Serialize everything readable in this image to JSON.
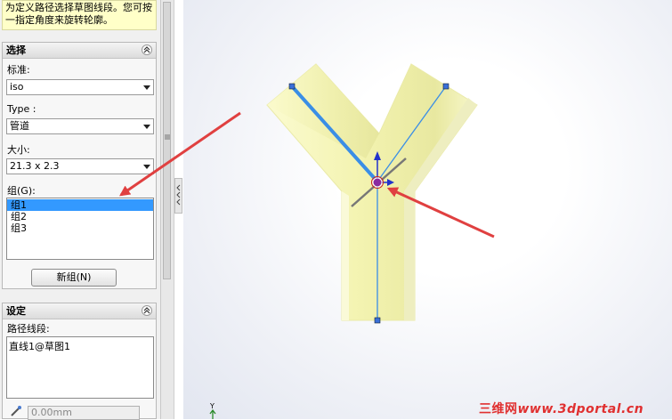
{
  "help_text": "为定义路径选择草图线段。您可按一指定角度来旋转轮廓。",
  "selection": {
    "title": "选择",
    "standard_label": "标准:",
    "standard_value": "iso",
    "type_label": "Type :",
    "type_value": "管道",
    "size_label": "大小:",
    "size_value": "21.3 x 2.3",
    "group_label": "组(G):",
    "groups": [
      "组1",
      "组2",
      "组3"
    ],
    "selected_group": "组1",
    "new_group_button": "新组(N)"
  },
  "settings": {
    "title": "设定",
    "path_label": "路径线段:",
    "path_value": "直线1@草图1",
    "rotation_value": "0.00mm"
  },
  "viewport": {
    "triad_axis_label": "Y",
    "watermark_cn": "三维网",
    "watermark_url": "www.3dportal.cn"
  },
  "colors": {
    "pipe_fill": "#f5f5b8",
    "sketch_line": "#3a8ee6",
    "arrow": "#e04040",
    "watermark": "#e03030",
    "selection": "#3399ff",
    "help_bg": "#ffffc8"
  }
}
